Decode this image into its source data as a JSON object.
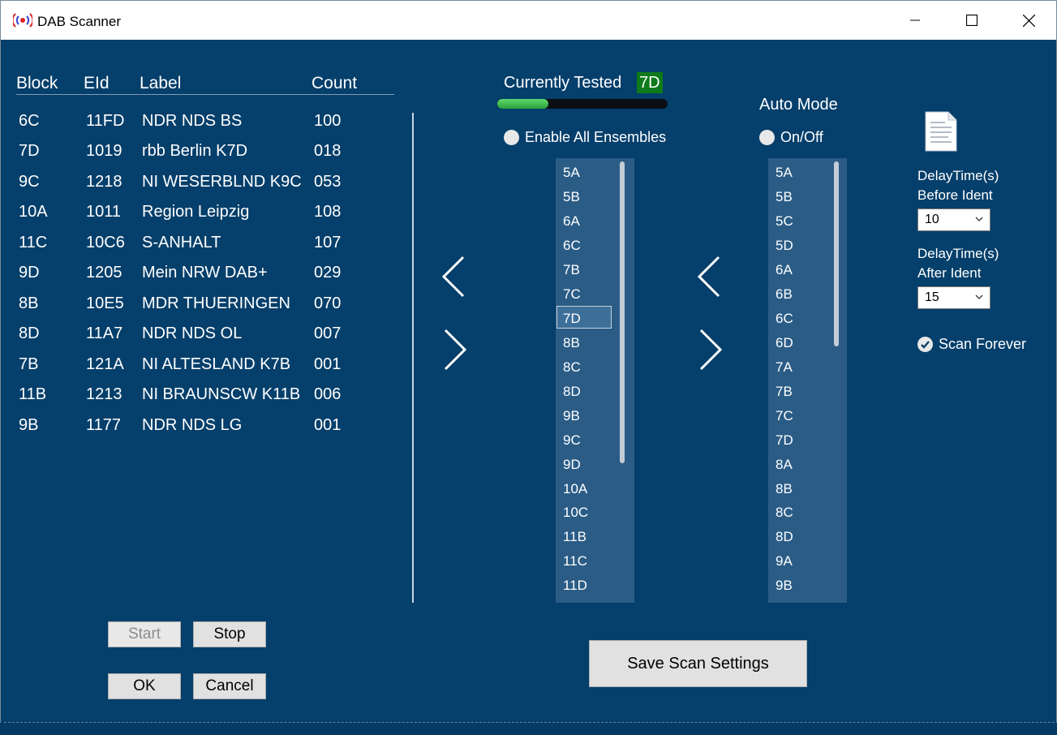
{
  "window": {
    "title": "DAB Scanner",
    "icons": {
      "app": "radio-broadcast-icon",
      "minimize": "minimize-icon",
      "maximize": "maximize-icon",
      "close": "close-icon"
    }
  },
  "results": {
    "columns": [
      "Block",
      "EId",
      "Label",
      "Count"
    ],
    "rows": [
      [
        "6C",
        "11FD",
        "NDR NDS BS",
        "100"
      ],
      [
        "7D",
        "1019",
        "rbb Berlin K7D",
        "018"
      ],
      [
        "9C",
        "1218",
        "NI WESERBLND K9C",
        "053"
      ],
      [
        "10A",
        "1011",
        "Region Leipzig",
        "108"
      ],
      [
        "11C",
        "10C6",
        "S-ANHALT",
        "107"
      ],
      [
        "9D",
        "1205",
        "Mein NRW DAB+",
        "029"
      ],
      [
        "8B",
        "10E5",
        "MDR THUERINGEN",
        "070"
      ],
      [
        "8D",
        "11A7",
        "NDR NDS OL",
        "007"
      ],
      [
        "7B",
        "121A",
        "NI ALTESLAND K7B",
        "001"
      ],
      [
        "11B",
        "1213",
        "NI BRAUNSCW K11B",
        "006"
      ],
      [
        "9B",
        "1177",
        "NDR NDS LG",
        "001"
      ]
    ]
  },
  "scan": {
    "currently_tested_label": "Currently Tested",
    "current_block": "7D",
    "progress": 0.3,
    "enable_all_label": "Enable All Ensembles",
    "ensemble_list": [
      "5A",
      "5B",
      "6A",
      "6C",
      "7B",
      "7C",
      "7D",
      "8B",
      "8C",
      "8D",
      "9B",
      "9C",
      "9D",
      "10A",
      "10C",
      "11B",
      "11C",
      "11D"
    ],
    "ensemble_selected": "7D"
  },
  "auto_mode": {
    "title": "Auto Mode",
    "toggle_label": "On/Off",
    "list": [
      "5A",
      "5B",
      "5C",
      "5D",
      "6A",
      "6B",
      "6C",
      "6D",
      "7A",
      "7B",
      "7C",
      "7D",
      "8A",
      "8B",
      "8C",
      "8D",
      "9A",
      "9B"
    ]
  },
  "settings": {
    "delay_before_label_1": "DelayTime(s)",
    "delay_before_label_2": "Before Ident",
    "delay_before_value": "10",
    "delay_after_label_1": "DelayTime(s)",
    "delay_after_label_2": "After Ident",
    "delay_after_value": "15",
    "scan_forever_label": "Scan Forever"
  },
  "buttons": {
    "start": "Start",
    "stop": "Stop",
    "ok": "OK",
    "cancel": "Cancel",
    "save": "Save Scan Settings"
  },
  "colors": {
    "background": "#053f6b",
    "listbox": "#2a5c86",
    "progress": "#3cbf4a",
    "badge": "#0e7a1a"
  }
}
